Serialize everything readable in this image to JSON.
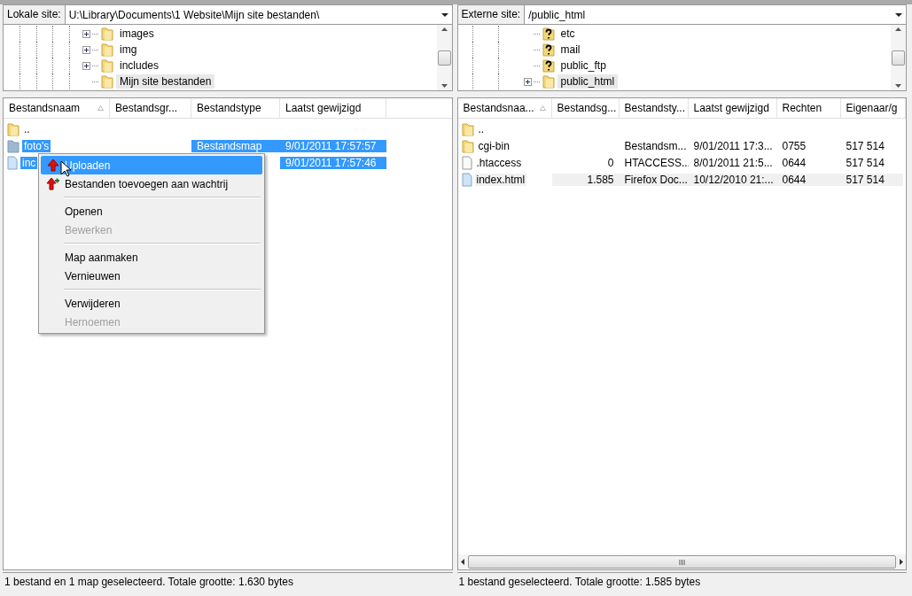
{
  "local": {
    "site_label": "Lokale site:",
    "path": "U:\\Library\\Documents\\1 Website\\Mijn site bestanden\\",
    "tree": [
      {
        "label": "images",
        "kind": "folder",
        "expandable": true,
        "selected": false
      },
      {
        "label": "img",
        "kind": "folder",
        "expandable": true,
        "selected": false
      },
      {
        "label": "includes",
        "kind": "folder",
        "expandable": true,
        "selected": false
      },
      {
        "label": "Mijn site bestanden",
        "kind": "folder",
        "expandable": false,
        "selected": true
      }
    ],
    "columns": [
      {
        "label": "Bestandsnaam",
        "sorted": true
      },
      {
        "label": "Bestandsgr...",
        "sorted": false
      },
      {
        "label": "Bestandstype",
        "sorted": false
      },
      {
        "label": "Laatst gewijzigd",
        "sorted": false
      }
    ],
    "rows": [
      {
        "kind": "folder",
        "cells": [
          "..",
          "",
          "",
          ""
        ],
        "selected": false
      },
      {
        "kind": "folder-dim",
        "cells": [
          "foto's",
          "",
          "Bestandsmap",
          "9/01/2011 17:57:57"
        ],
        "selected": true
      },
      {
        "kind": "file",
        "cells": [
          "inc",
          "",
          "",
          "9/01/2011 17:57:46"
        ],
        "selected": true
      }
    ],
    "status": "1 bestand en 1 map geselecteerd. Totale grootte: 1.630 bytes"
  },
  "remote": {
    "site_label": "Externe site:",
    "path": "/public_html",
    "tree": [
      {
        "label": "etc",
        "kind": "unknown",
        "expandable": false,
        "selected": false
      },
      {
        "label": "mail",
        "kind": "unknown",
        "expandable": false,
        "selected": false
      },
      {
        "label": "public_ftp",
        "kind": "unknown",
        "expandable": false,
        "selected": false
      },
      {
        "label": "public_html",
        "kind": "folder",
        "expandable": true,
        "selected": true
      }
    ],
    "columns": [
      {
        "label": "Bestandsnaa...",
        "sorted": true
      },
      {
        "label": "Bestandsg...",
        "sorted": false
      },
      {
        "label": "Bestandsty...",
        "sorted": false
      },
      {
        "label": "Laatst gewijzigd",
        "sorted": false
      },
      {
        "label": "Rechten",
        "sorted": false
      },
      {
        "label": "Eigenaar/g",
        "sorted": false
      }
    ],
    "rows": [
      {
        "kind": "folder",
        "cells": [
          "..",
          "",
          "",
          "",
          "",
          ""
        ],
        "selected": false
      },
      {
        "kind": "folder",
        "cells": [
          "cgi-bin",
          "",
          "Bestandsm...",
          "9/01/2011 17:3...",
          "0755",
          "517 514"
        ],
        "selected": false
      },
      {
        "kind": "file-plain",
        "cells": [
          ".htaccess",
          "0",
          "HTACCESS...",
          "8/01/2011 21:5...",
          "0644",
          "517 514"
        ],
        "selected": false
      },
      {
        "kind": "file",
        "cells": [
          "index.html",
          "1.585",
          "Firefox Doc...",
          "10/12/2010 21:...",
          "0644",
          "517 514"
        ],
        "selected": true
      }
    ],
    "status": "1 bestand geselecteerd. Totale grootte: 1.585 bytes"
  },
  "context_menu": [
    {
      "kind": "upload",
      "label": "Uploaden",
      "disabled": false,
      "selected": true
    },
    {
      "kind": "queue",
      "label": "Bestanden toevoegen aan wachtrij",
      "disabled": false,
      "selected": false
    },
    {
      "kind": "separator"
    },
    {
      "kind": "item",
      "label": "Openen",
      "disabled": false,
      "selected": false
    },
    {
      "kind": "item",
      "label": "Bewerken",
      "disabled": true,
      "selected": false
    },
    {
      "kind": "separator"
    },
    {
      "kind": "item",
      "label": "Map aanmaken",
      "disabled": false,
      "selected": false
    },
    {
      "kind": "item",
      "label": "Vernieuwen",
      "disabled": false,
      "selected": false
    },
    {
      "kind": "separator"
    },
    {
      "kind": "item",
      "label": "Verwijderen",
      "disabled": false,
      "selected": false
    },
    {
      "kind": "item",
      "label": "Hernoemen",
      "disabled": true,
      "selected": false
    }
  ]
}
